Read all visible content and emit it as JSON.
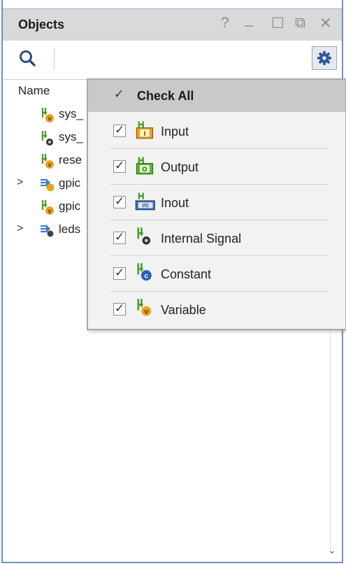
{
  "panel": {
    "title": "Objects"
  },
  "window_buttons": [
    {
      "name": "help-button",
      "glyph": "?"
    },
    {
      "name": "minimize-button",
      "glyph": "_"
    },
    {
      "name": "maximize-button",
      "glyph": "☐"
    },
    {
      "name": "float-button",
      "glyph": "⧉"
    },
    {
      "name": "close-button",
      "glyph": "✕"
    }
  ],
  "toolbar": {
    "search_icon": "search-icon",
    "settings_icon": "gear-icon"
  },
  "tree": {
    "column_header": "Name",
    "rows": [
      {
        "label": "sys_",
        "icon": "variable-signal-icon",
        "expandable": false
      },
      {
        "label": "sys_",
        "icon": "internal-signal-icon",
        "expandable": false
      },
      {
        "label": "rese",
        "icon": "variable-signal-icon",
        "expandable": false
      },
      {
        "label": "gpic",
        "icon": "bus-variable-icon",
        "expandable": true
      },
      {
        "label": "gpic",
        "icon": "variable-signal-icon",
        "expandable": false
      },
      {
        "label": "leds",
        "icon": "bus-internal-icon",
        "expandable": true
      }
    ],
    "expand_glyph": ">"
  },
  "filter_menu": {
    "check_all": {
      "label": "Check All",
      "checked": true
    },
    "items": [
      {
        "label": "Input",
        "checked": true,
        "icon": "input-port-icon"
      },
      {
        "label": "Output",
        "checked": true,
        "icon": "output-port-icon"
      },
      {
        "label": "Inout",
        "checked": true,
        "icon": "inout-port-icon"
      },
      {
        "label": "Internal Signal",
        "checked": true,
        "icon": "internal-signal-icon"
      },
      {
        "label": "Constant",
        "checked": true,
        "icon": "constant-icon"
      },
      {
        "label": "Variable",
        "checked": true,
        "icon": "variable-icon"
      }
    ]
  },
  "scroll_glyph": "⌄",
  "colors": {
    "panel_border": "#6f8fc8",
    "title_bg": "#d8d9db",
    "menu_header_bg": "#c9c9c9",
    "gear_blue": "#2b5a9a",
    "signal_green": "#4a9a28",
    "badge_orange": "#e8a21b"
  }
}
